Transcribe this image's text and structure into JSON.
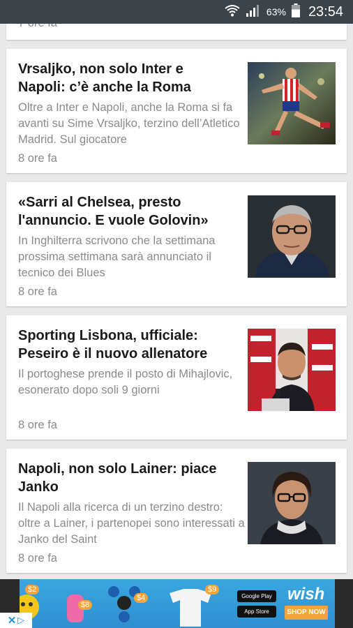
{
  "status": {
    "battery_pct": "63%",
    "time": "23:54"
  },
  "partial_card": {
    "time": "7 ore fa"
  },
  "articles": [
    {
      "title": "Vrsaljko, non solo Inter e Napoli: c’è anche la Roma",
      "desc": "Oltre a Inter e Napoli, anche la Roma si fa avanti su Sime Vrsaljko, terzino dell’Atletico Madrid. Sul giocatore",
      "time": "8 ore fa"
    },
    {
      "title": "«Sarri al Chelsea, presto l'annuncio. E vuole Golovin»",
      "desc": "In Inghilterra scrivono che la settimana prossima settimana sarà annunciato il tecnico dei Blues",
      "time": "8 ore fa"
    },
    {
      "title": "Sporting Lisbona, ufficiale: Peseiro è il nuovo allenatore",
      "desc": "Il portoghese prende il posto di Mihajlovic, esonerato dopo soli 9 giorni",
      "time": "8 ore fa"
    },
    {
      "title": "Napoli, non solo Lainer: piace Janko",
      "desc": "Il Napoli alla ricerca di un terzino destro: oltre a Lainer, i partenopei sono interessati a Janko del Saint",
      "time": "8 ore fa"
    }
  ],
  "ad": {
    "brand": "wish",
    "cta": "SHOP NOW",
    "store1": "Google Play",
    "store2": "App Store",
    "prices": [
      "$2",
      "$8",
      "$4",
      "$9"
    ]
  }
}
